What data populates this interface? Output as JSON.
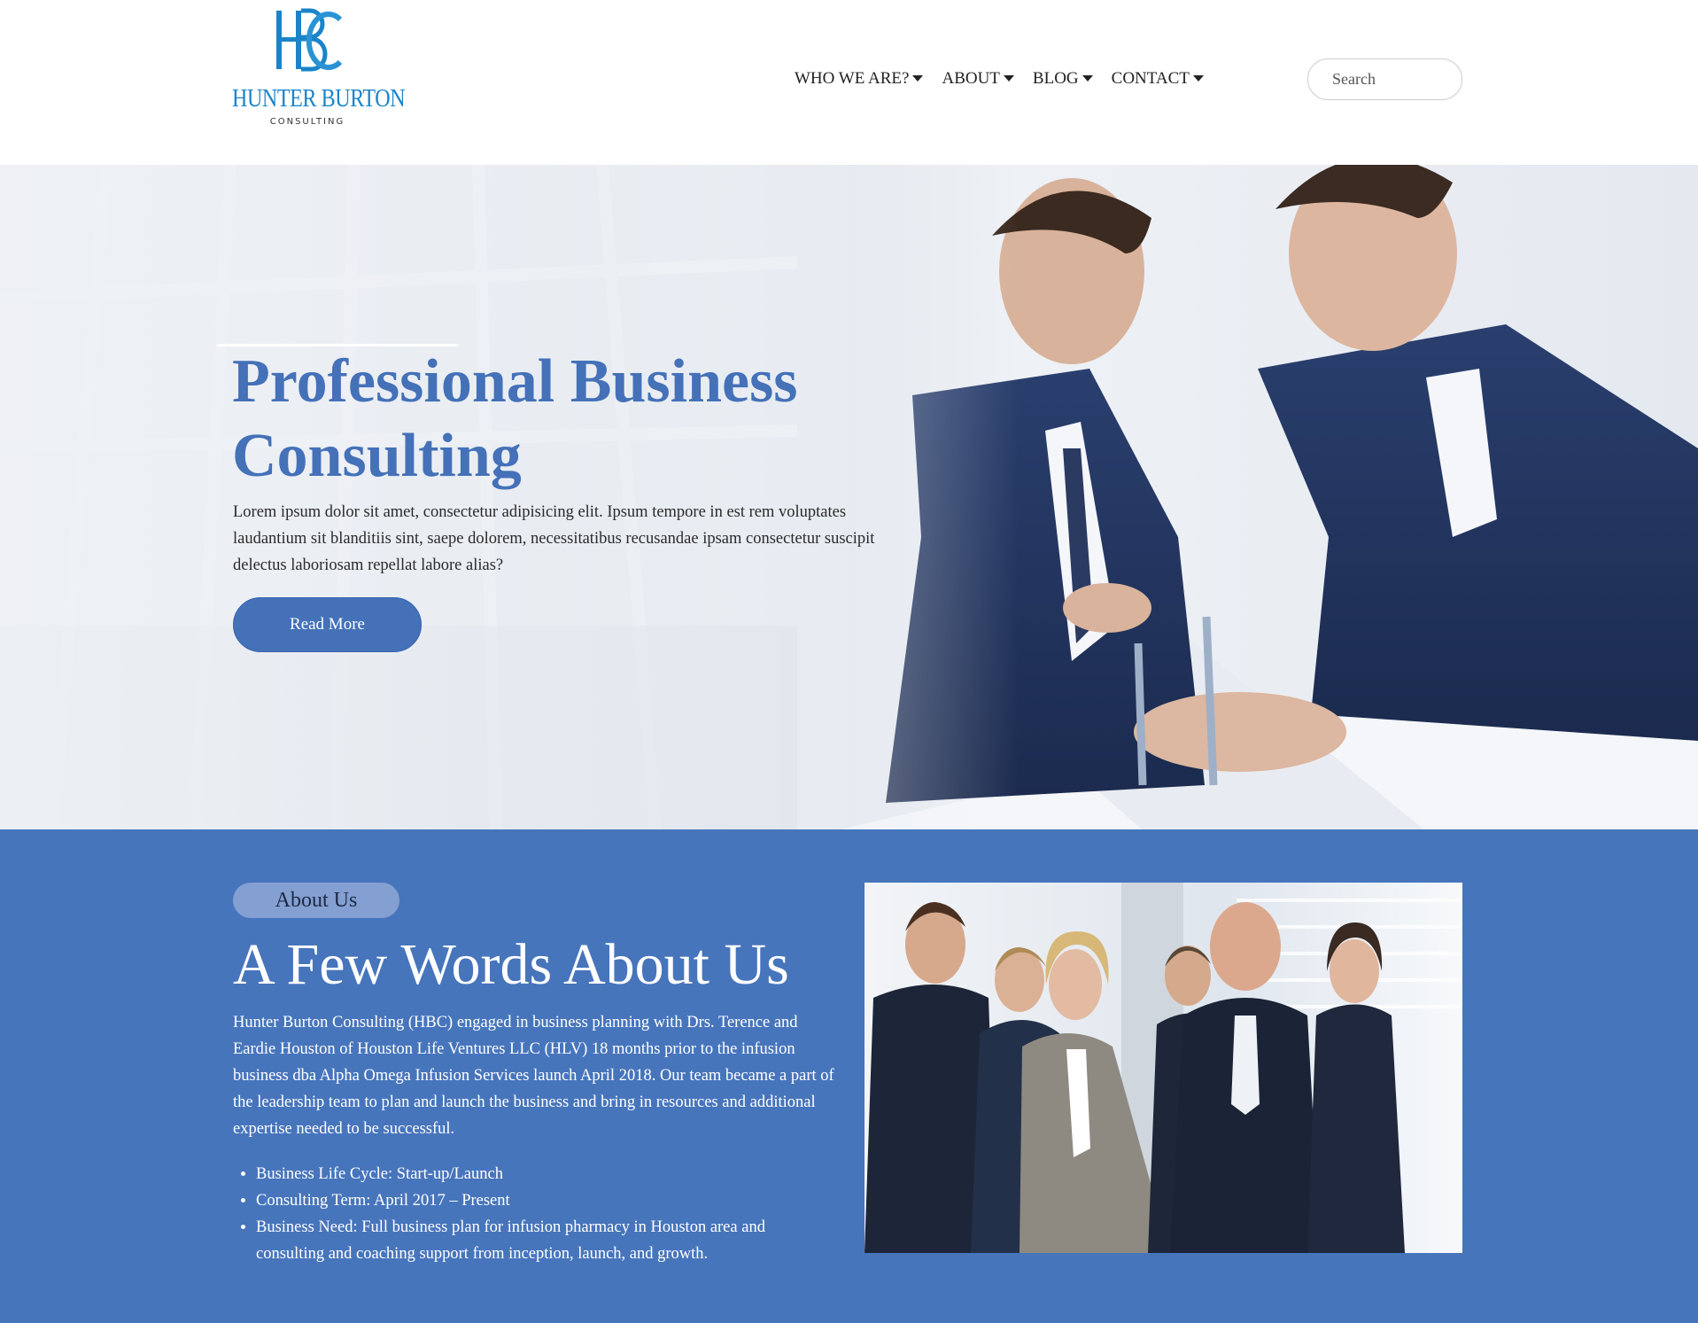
{
  "header": {
    "logo": {
      "name": "HUNTER BURTON",
      "sub": "CONSULTING",
      "mark_color": "#1a84c9"
    },
    "nav": [
      {
        "label": "WHO WE ARE?",
        "icon": "caret-down-icon"
      },
      {
        "label": "ABOUT",
        "icon": "caret-down-icon"
      },
      {
        "label": "BLOG",
        "icon": "caret-down-icon"
      },
      {
        "label": "CONTACT",
        "icon": "caret-down-icon"
      }
    ],
    "search": {
      "placeholder": "Search",
      "value": ""
    }
  },
  "hero": {
    "title": "Professional Business Consulting",
    "text": "Lorem ipsum dolor sit amet, consectetur adipisicing elit. Ipsum tempore in est rem voluptates laudantium sit blanditiis sint, saepe dolorem, necessitatibus recusandae ipsam consectetur suscipit delectus laboriosam repellat labore alias?",
    "button": "Read More",
    "image": "business-meeting-photo"
  },
  "about": {
    "badge": "About Us",
    "title": "A Few Words About Us",
    "text": "Hunter Burton Consulting (HBC) engaged in business planning with Drs. Terence and Eardie Houston of Houston Life Ventures LLC (HLV) 18 months prior to the infusion business dba Alpha Omega Infusion Services launch April 2018. Our team became a part of the leadership team to plan and launch the business and bring in resources and additional expertise needed to be successful.",
    "list": [
      "Business Life Cycle: Start-up/Launch",
      "Consulting Term: April 2017 – Present",
      "Business Need: Full business plan for infusion pharmacy in Houston area and consulting and coaching support from inception, launch, and growth."
    ],
    "image": "team-photo"
  },
  "colors": {
    "brand_blue": "#4471b8",
    "section_blue": "#4775bc",
    "badge_bg": "#849fd1",
    "logo_blue": "#1a84c9"
  }
}
